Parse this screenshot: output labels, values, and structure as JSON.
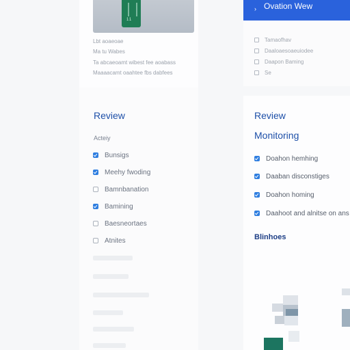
{
  "left_panel": {
    "preview_device_label": "11",
    "captions": [
      "Lbt aoaeoae",
      "Ma tu Wabes",
      "Ta abcaeoamt wibest fee aoabass",
      "Maaaacamt oaahtee fbs dabfees"
    ],
    "review_title": "Review",
    "activity_label": "Acteiy",
    "checklist": [
      {
        "label": "Bunsigs",
        "checked": true
      },
      {
        "label": "Meehy fwoding",
        "checked": true
      },
      {
        "label": "Bamnbanation",
        "checked": false
      },
      {
        "label": "Bamining",
        "checked": true
      },
      {
        "label": "Baesneortaes",
        "checked": false
      },
      {
        "label": "Atnites",
        "checked": false
      }
    ]
  },
  "right_panel": {
    "overview_title": "Ovation Wew",
    "chevron_icon": "chevron-right-icon",
    "mini_items": [
      "Tamaofhav",
      "Daaloaesoaeuiodee",
      "Daapon Baming",
      "Se"
    ],
    "review_title": "Review",
    "monitoring_title": "Monitoring",
    "checklist": [
      {
        "label": "Doahon hemhing",
        "checked": true
      },
      {
        "label": "Daaban disconstiges",
        "checked": true
      },
      {
        "label": "Doahon homing",
        "checked": true
      },
      {
        "label": "Daahoot and alnitse on ans",
        "checked": true
      }
    ],
    "strong_label": "Blinhoes"
  },
  "colors": {
    "accent": "#2a62dc",
    "title_blue": "#1d4fa8",
    "checkbox_on": "#2f7ee0",
    "device_green": "#1f7d55"
  }
}
